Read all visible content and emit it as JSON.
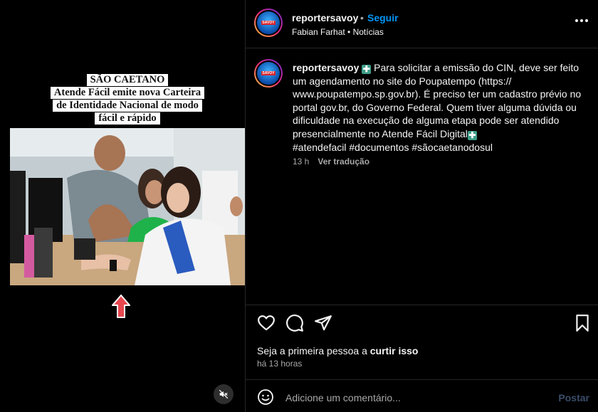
{
  "media": {
    "headline_lines": [
      "SÃO CAETANO",
      "Atende Fácil emite nova Carteira",
      "de Identidade Nacional de modo",
      "fácil e rápido"
    ],
    "arrow_color": "#e8474f",
    "mute_icon": "speaker-muted-icon"
  },
  "post_header": {
    "username": "reportersavoy",
    "separator": "•",
    "follow_label": "Seguir",
    "subline": "Fabian Farhat • Notícias",
    "avatar_logo_text": "SAVOY"
  },
  "caption": {
    "username": "reportersavoy",
    "emoji_start": "✚",
    "text": "Para solicitar a emissão do CIN, deve ser feito um agendamento no site do Poupatempo (https:// www.poupatempo.sp.gov.br). É preciso ter um cadastro prévio no portal gov.br, do Governo Federal. Quem tiver alguma dúvida ou dificuldade na execução de alguma etapa pode ser atendido presencialmente no Atende Fácil Digital",
    "emoji_end": "✚",
    "hashtags": "#atendefacil #documentos #sãocaetanodosul",
    "age": "13 h",
    "translate_label": "Ver tradução"
  },
  "actions": {
    "like_prefix": "Seja a primeira pessoa a ",
    "like_link": "curtir isso",
    "timestamp": "há 13 horas"
  },
  "comment": {
    "placeholder": "Adicione um comentário...",
    "post_label": "Postar"
  },
  "colors": {
    "accent": "#0095f6",
    "post_disabled": "#3a4d6b",
    "border": "#262626"
  }
}
